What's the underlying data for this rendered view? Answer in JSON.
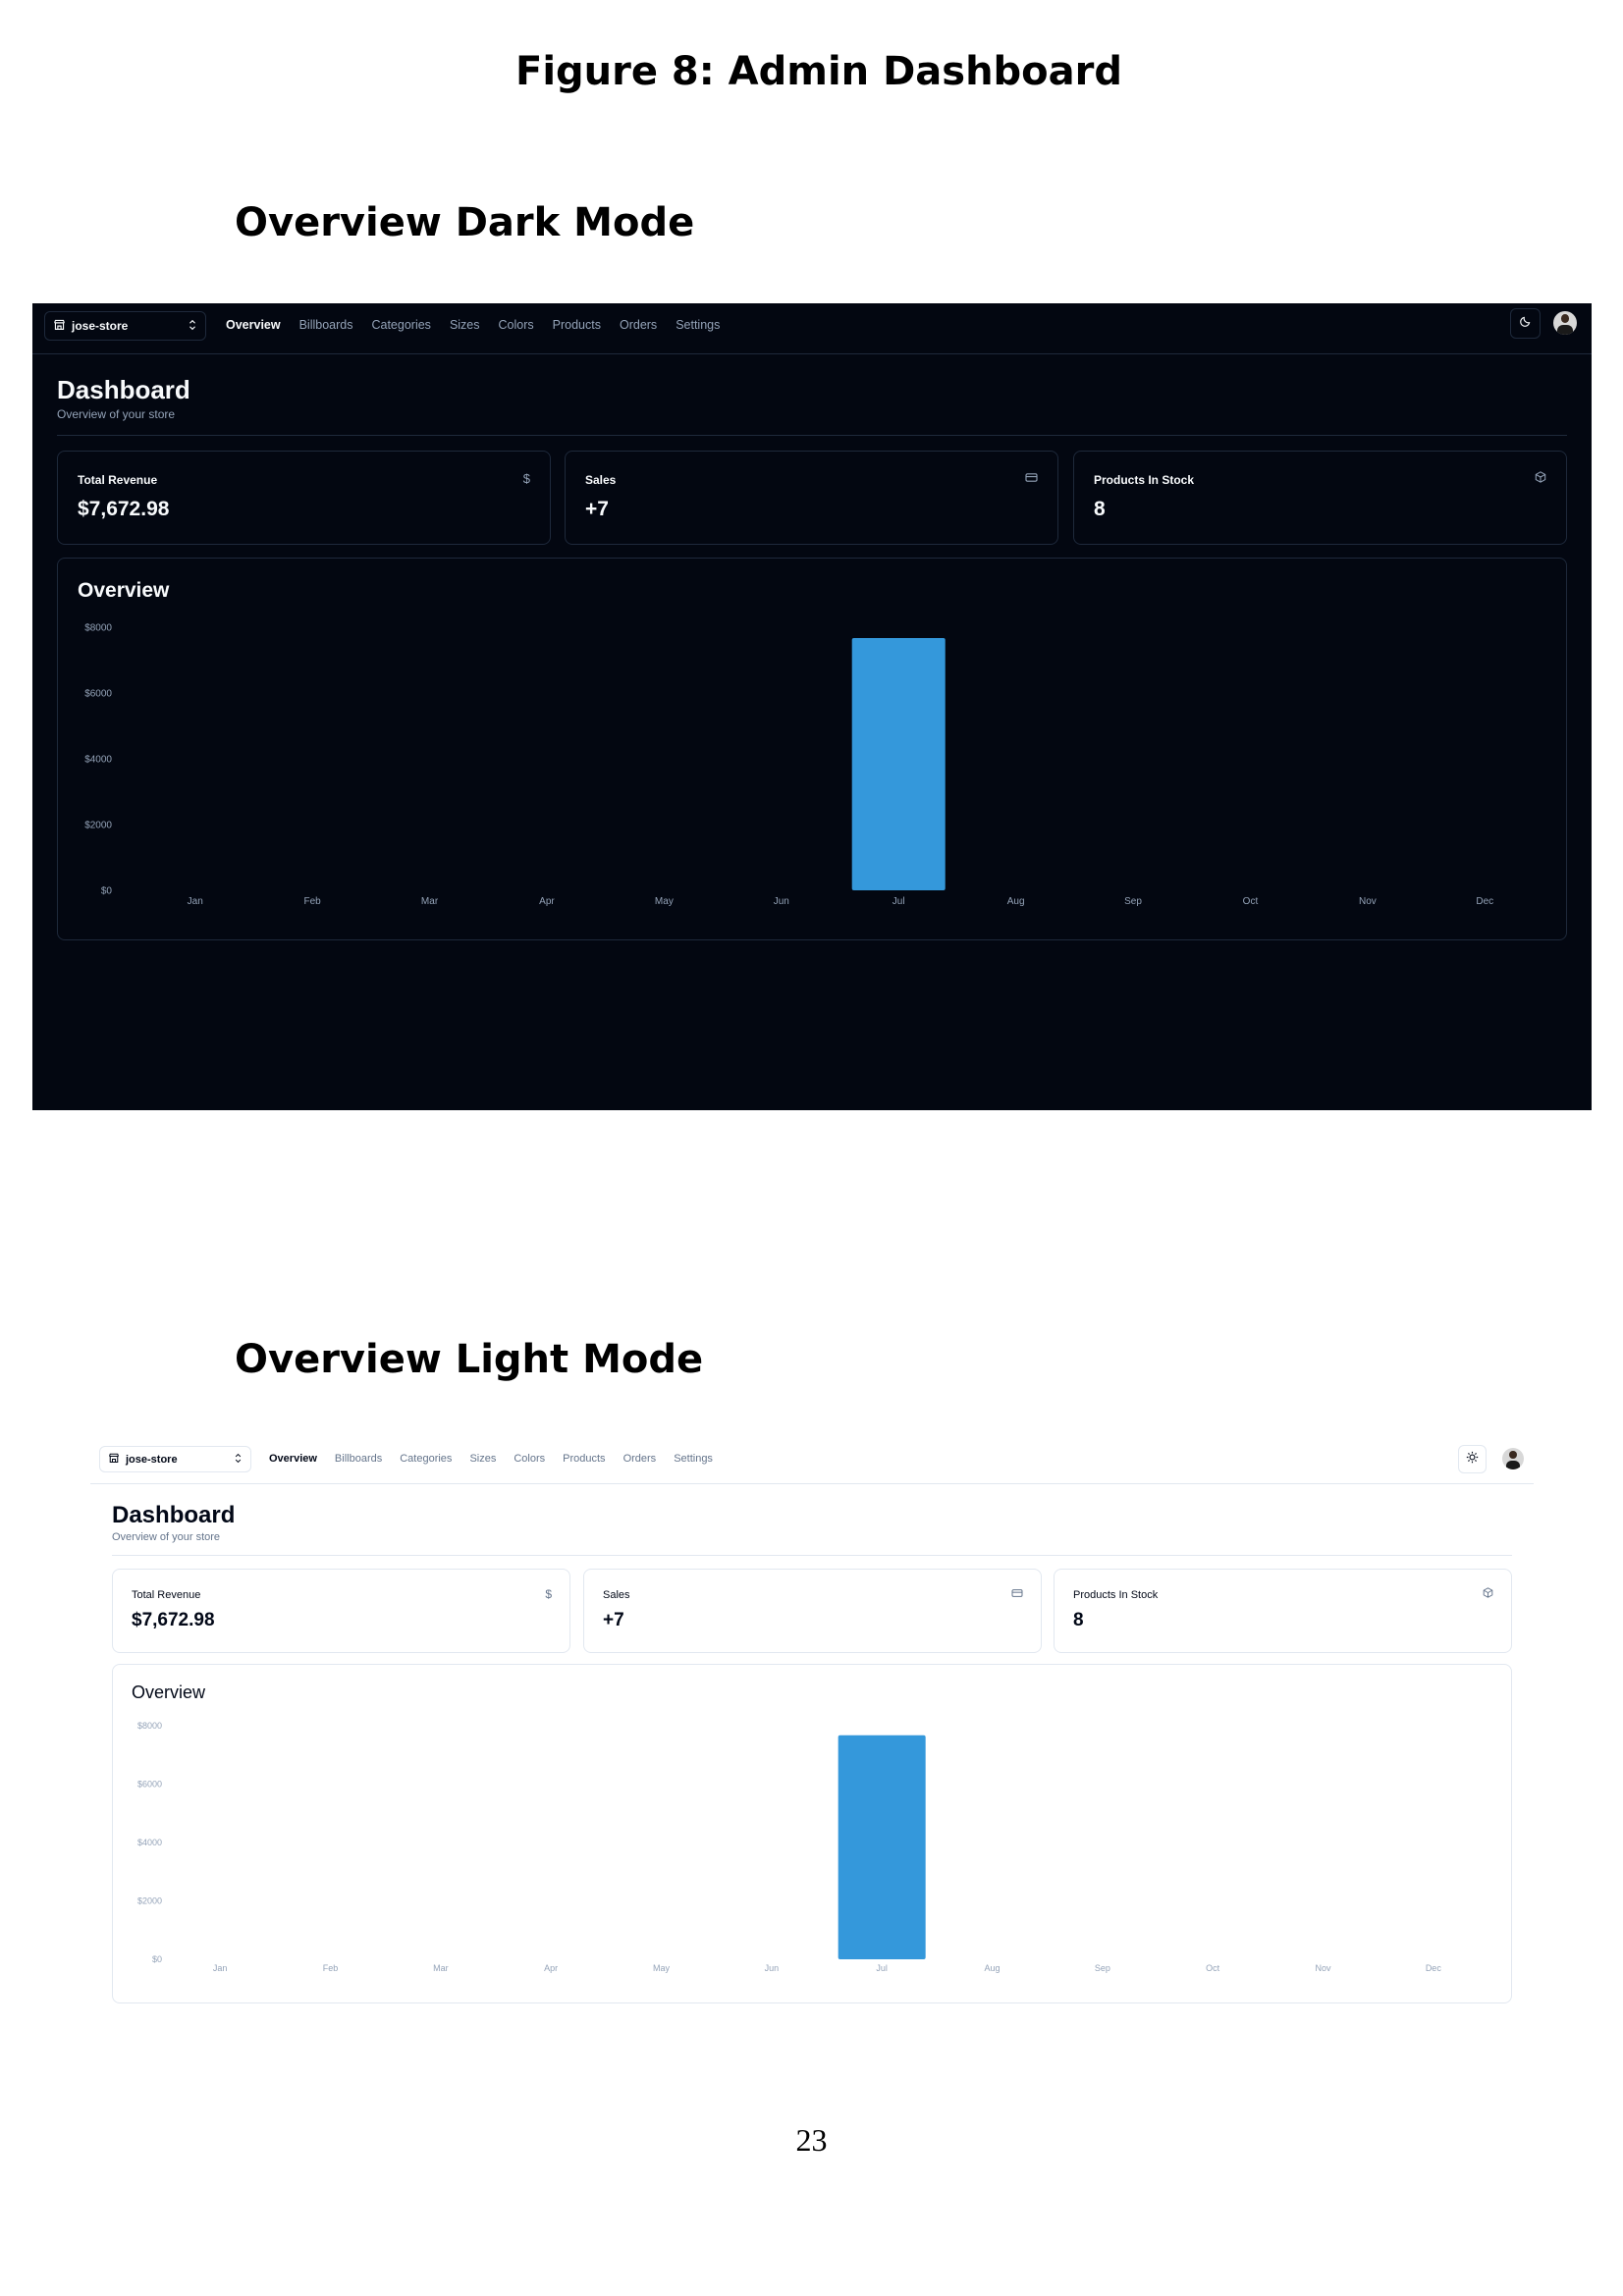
{
  "document": {
    "figure_title": "Figure 8: Admin Dashboard",
    "dark_heading": "Overview Dark Mode",
    "light_heading": "Overview Light Mode",
    "page_number": "23"
  },
  "dashboard": {
    "store_name": "jose-store",
    "nav": [
      "Overview",
      "Billboards",
      "Categories",
      "Sizes",
      "Colors",
      "Products",
      "Orders",
      "Settings"
    ],
    "active_nav": "Overview",
    "title": "Dashboard",
    "subtitle": "Overview of your store",
    "cards": [
      {
        "title": "Total Revenue",
        "value": "$7,672.98",
        "icon": "dollar-icon"
      },
      {
        "title": "Sales",
        "value": "+7",
        "icon": "credit-card-icon"
      },
      {
        "title": "Products In Stock",
        "value": "8",
        "icon": "package-icon"
      }
    ],
    "chart_title": "Overview"
  },
  "themes": {
    "dark": {
      "background": "#030711",
      "text": "#f8fafc",
      "muted": "#94a3b8",
      "border": "#1e293b",
      "theme_icon": "moon-icon"
    },
    "light": {
      "background": "#ffffff",
      "text": "#020817",
      "muted": "#64748b",
      "border": "#e2e8f0",
      "theme_icon": "sun-icon"
    }
  },
  "chart_data": {
    "type": "bar",
    "categories": [
      "Jan",
      "Feb",
      "Mar",
      "Apr",
      "May",
      "Jun",
      "Jul",
      "Aug",
      "Sep",
      "Oct",
      "Nov",
      "Dec"
    ],
    "values": [
      0,
      0,
      0,
      0,
      0,
      0,
      7672.98,
      0,
      0,
      0,
      0,
      0
    ],
    "ylim": [
      0,
      8000
    ],
    "yticks": [
      "$0",
      "$2000",
      "$4000",
      "$6000",
      "$8000"
    ],
    "ytick_values": [
      0,
      2000,
      4000,
      6000,
      8000
    ],
    "bar_color": "#3498db",
    "grid": false
  }
}
